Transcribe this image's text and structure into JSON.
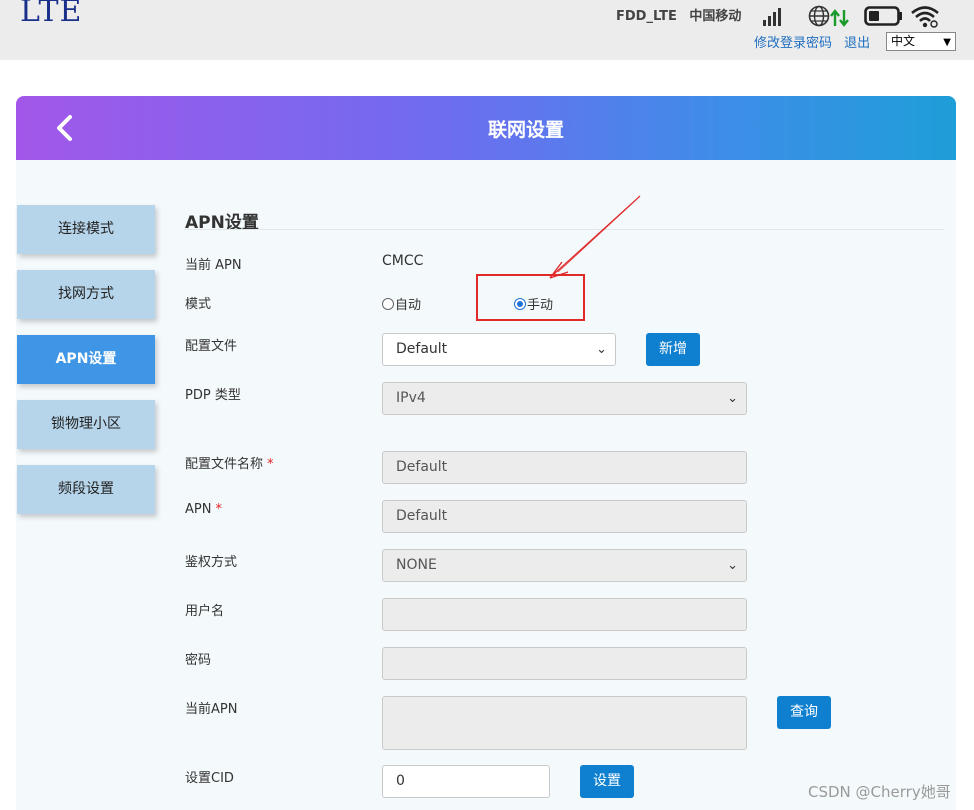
{
  "topbar": {
    "logo": "LTE",
    "network_type": "FDD_LTE",
    "carrier": "中国移动",
    "icons": [
      "signal-icon",
      "globe-icon",
      "data-transfer-icon",
      "battery-icon",
      "wifi-icon"
    ],
    "change_password": "修改登录密码",
    "logout": "退出",
    "language": "中文"
  },
  "header": {
    "title": "联网设置"
  },
  "sidebar": {
    "items": [
      {
        "label": "连接模式"
      },
      {
        "label": "找网方式"
      },
      {
        "label": "APN设置"
      },
      {
        "label": "锁物理小区"
      },
      {
        "label": "频段设置"
      }
    ]
  },
  "form": {
    "section_title": "APN设置",
    "current_apn_label": "当前 APN",
    "current_apn_value": "CMCC",
    "mode_label": "模式",
    "mode_auto": "自动",
    "mode_manual": "手动",
    "mode_selected": "手动",
    "profile_label": "配置文件",
    "profile_value": "Default",
    "add_button": "新增",
    "pdp_label": "PDP 类型",
    "pdp_value": "IPv4",
    "profile_name_label": "配置文件名称",
    "profile_name_value": "Default",
    "apn_label": "APN",
    "apn_value": "Default",
    "auth_label": "鉴权方式",
    "auth_value": "NONE",
    "username_label": "用户名",
    "username_value": "",
    "password_label": "密码",
    "password_value": "",
    "cur_apn_label": "当前APN",
    "cur_apn_value": "",
    "query_button": "查询",
    "cid_label": "设置CID",
    "cid_value": "0",
    "set_button": "设置",
    "required_mark": "*"
  },
  "watermark": "CSDN @Cherry她哥",
  "colors": {
    "accent": "#0f7fd0",
    "active_nav": "#3f96e6",
    "nav": "#b6d5ea",
    "annotation": "#e02a2a"
  }
}
